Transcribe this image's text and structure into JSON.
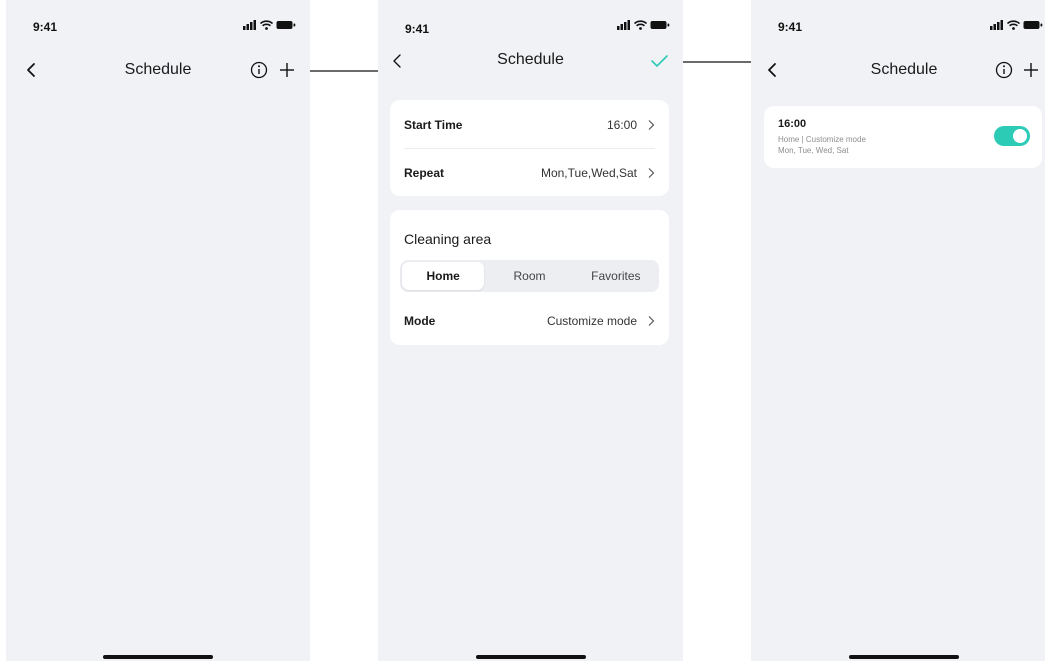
{
  "status_bar": {
    "time": "9:41"
  },
  "screen1": {
    "title": "Schedule",
    "icons": {
      "back": "chevron-left-icon",
      "info": "info-circle-icon",
      "add": "plus-icon"
    }
  },
  "screen2": {
    "title": "Schedule",
    "icons": {
      "back": "chevron-left-icon",
      "confirm": "checkmark-icon"
    },
    "rows": [
      {
        "label": "Start Time",
        "value": "16:00"
      },
      {
        "label": "Repeat",
        "value": "Mon,Tue,Wed,Sat"
      }
    ],
    "cleaning_area": {
      "title": "Cleaning area",
      "tabs": [
        "Home",
        "Room",
        "Favorites"
      ],
      "selected_tab": "Home",
      "mode_label": "Mode",
      "mode_value": "Customize mode"
    }
  },
  "screen3": {
    "title": "Schedule",
    "icons": {
      "back": "chevron-left-icon",
      "info": "info-circle-icon",
      "add": "plus-icon"
    },
    "schedule_item": {
      "time": "16:00",
      "details": "Home | Customize mode",
      "days": "Mon, Tue, Wed, Sat",
      "enabled": true
    }
  },
  "colors": {
    "screen_bg": "#f1f2f5",
    "card_bg": "#ffffff",
    "accent": "#2bcbb6"
  }
}
